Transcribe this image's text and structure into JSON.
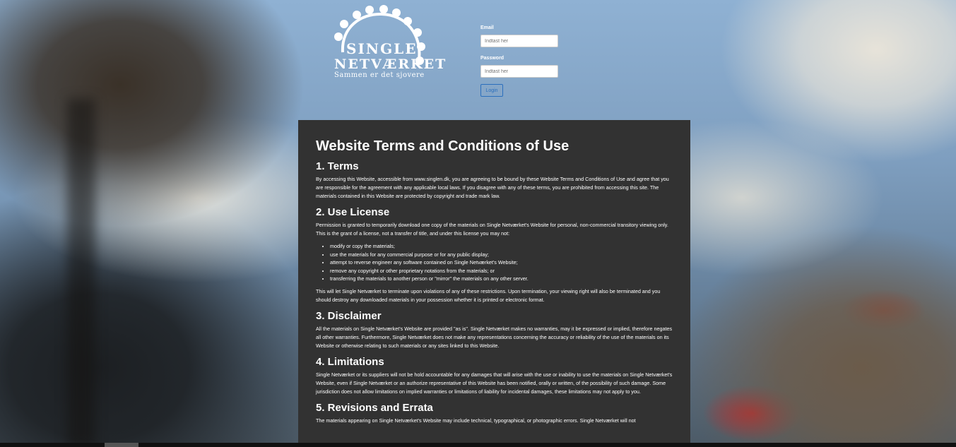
{
  "logo": {
    "line1": "SINGLE",
    "line2": "NETVÆRKET",
    "tagline": "Sammen er det sjovere"
  },
  "login": {
    "email_label": "Email",
    "email_placeholder": "Indtast her",
    "password_label": "Password",
    "password_placeholder": "Indtast her",
    "login_button": "Login"
  },
  "terms": {
    "title": "Website Terms and Conditions of Use",
    "s1_heading": "1. Terms",
    "s1_text": "By accessing this Website, accessible from www.singlen.dk, you are agreeing to be bound by these Website Terms and Conditions of Use and agree that you are responsible for the agreement with any applicable local laws. If you disagree with any of these terms, you are prohibited from accessing this site. The materials contained in this Website are protected by copyright and trade mark law.",
    "s2_heading": "2. Use License",
    "s2_text": "Permission is granted to temporarily download one copy of the materials on Single Netværket's Website for personal, non-commercial transitory viewing only. This is the grant of a license, not a transfer of title, and under this license you may not:",
    "s2_items": [
      "modify or copy the materials;",
      "use the materials for any commercial purpose or for any public display;",
      "attempt to reverse engineer any software contained on Single Netværket's Website;",
      "remove any copyright or other proprietary notations from the materials; or",
      "transferring the materials to another person or \"mirror\" the materials on any other server."
    ],
    "s2_text2": "This will let Single Netværket to terminate upon violations of any of these restrictions. Upon termination, your viewing right will also be terminated and you should destroy any downloaded materials in your possession whether it is printed or electronic format.",
    "s3_heading": "3. Disclaimer",
    "s3_text": "All the materials on Single Netværket's Website are provided \"as is\". Single Netværket makes no warranties, may it be expressed or implied, therefore negates all other warranties. Furthermore, Single Netværket does not make any representations concerning the accuracy or reliability of the use of the materials on its Website or otherwise relating to such materials or any sites linked to this Website.",
    "s4_heading": "4. Limitations",
    "s4_text": "Single Netværket or its suppliers will not be hold accountable for any damages that will arise with the use or inability to use the materials on Single Netværket's Website, even if Single Netværket or an authorize representative of this Website has been notified, orally or written, of the possibility of such damage. Some jurisdiction does not allow limitations on implied warranties or limitations of liability for incidental damages, these limitations may not apply to you.",
    "s5_heading": "5. Revisions and Errata",
    "s5_text": "The materials appearing on Single Netværket's Website may include technical, typographical, or photographic errors. Single Netværket will not"
  }
}
